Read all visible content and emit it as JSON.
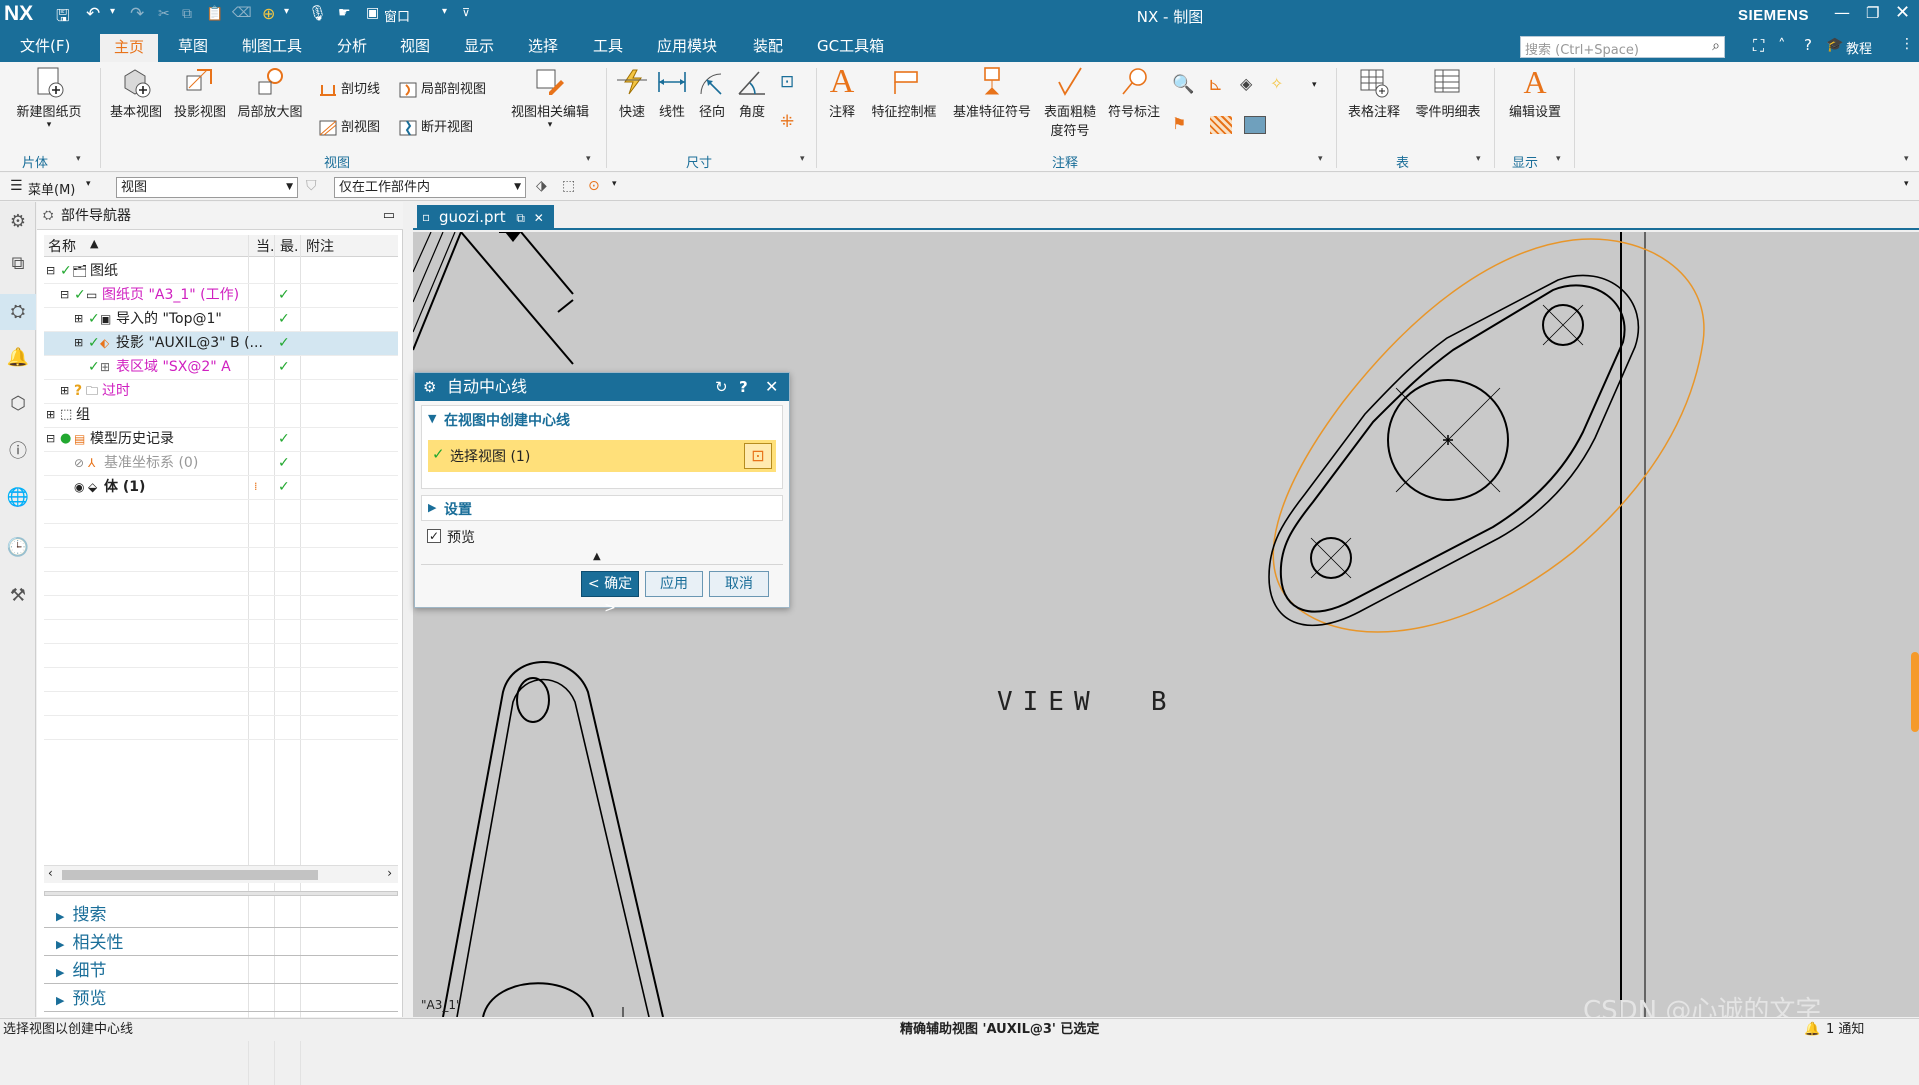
{
  "app": {
    "logo": "NX",
    "title": "NX - 制图",
    "brand": "SIEMENS",
    "window_menu": "窗口",
    "search_placeholder": "搜索 (Ctrl+Space)",
    "tutorial": "教程"
  },
  "menu_tabs": [
    "文件(F)",
    "主页",
    "草图",
    "制图工具",
    "分析",
    "视图",
    "显示",
    "选择",
    "工具",
    "应用模块",
    "装配",
    "GC工具箱"
  ],
  "ribbon": {
    "new_sheet": "新建图纸页",
    "base_view": "基本视图",
    "projected_view": "投影视图",
    "detail_view": "局部放大图",
    "section_line": "剖切线",
    "section_view": "剖视图",
    "break_out_section": "局部剖视图",
    "broken_view": "断开视图",
    "view_dependent_edit": "视图相关编辑",
    "rapid": "快速",
    "linear": "线性",
    "radial": "径向",
    "angular": "角度",
    "note": "注释",
    "fcf": "特征控制框",
    "datum_feature": "基准特征符号",
    "surface_finish_1": "表面粗糙",
    "surface_finish_2": "度符号",
    "balloon": "符号标注",
    "table_note": "表格注释",
    "parts_list": "零件明细表",
    "edit_settings": "编辑设置",
    "groups": {
      "sheet": "片体",
      "view": "视图",
      "dimension": "尺寸",
      "annotation": "注释",
      "table": "表",
      "display": "显示"
    }
  },
  "toolbar2": {
    "menu": "菜单(M)",
    "filter": "视图",
    "scope": "仅在工作部件内"
  },
  "navigator": {
    "title": "部件导航器",
    "columns": [
      "名称",
      "当.",
      "最.",
      "附注"
    ],
    "rows": [
      {
        "label": "图纸",
        "color": "#222"
      },
      {
        "label": "图纸页 \"A3_1\" (工作)",
        "color": "#d020c0"
      },
      {
        "label": "导入的 \"Top@1\"",
        "color": "#222"
      },
      {
        "label": "投影 \"AUXIL@3\" B (...",
        "color": "#222"
      },
      {
        "label": "表区域 \"SX@2\" A",
        "color": "#d020c0"
      },
      {
        "label": "过时",
        "color": "#d020c0"
      },
      {
        "label": "组",
        "color": "#222"
      },
      {
        "label": "模型历史记录",
        "color": "#222"
      },
      {
        "label": "基准坐标系 (0)",
        "color": "#999"
      },
      {
        "label": "体 (1)",
        "color": "#111"
      }
    ],
    "panes": [
      "搜索",
      "相关性",
      "细节",
      "预览"
    ]
  },
  "graphics": {
    "tab": "guozi.prt",
    "view_label": "VIEW  B",
    "sheet_label": "\"A3_1\""
  },
  "dialog": {
    "title": "自动中心线",
    "section1": "在视图中创建中心线",
    "select_view": "选择视图 (1)",
    "section2": "设置",
    "preview": "预览",
    "ok": "< 确定 >",
    "apply": "应用",
    "cancel": "取消"
  },
  "status": {
    "left": "选择视图以创建中心线",
    "center": "精确辅助视图 'AUXIL@3' 已选定",
    "notify": "1 通知"
  },
  "watermark": "CSDN @心诚的文字",
  "colors": {
    "brand": "#1a6e99",
    "accent": "#e8731a",
    "highlight": "#ffe07a",
    "check": "#22a830"
  }
}
